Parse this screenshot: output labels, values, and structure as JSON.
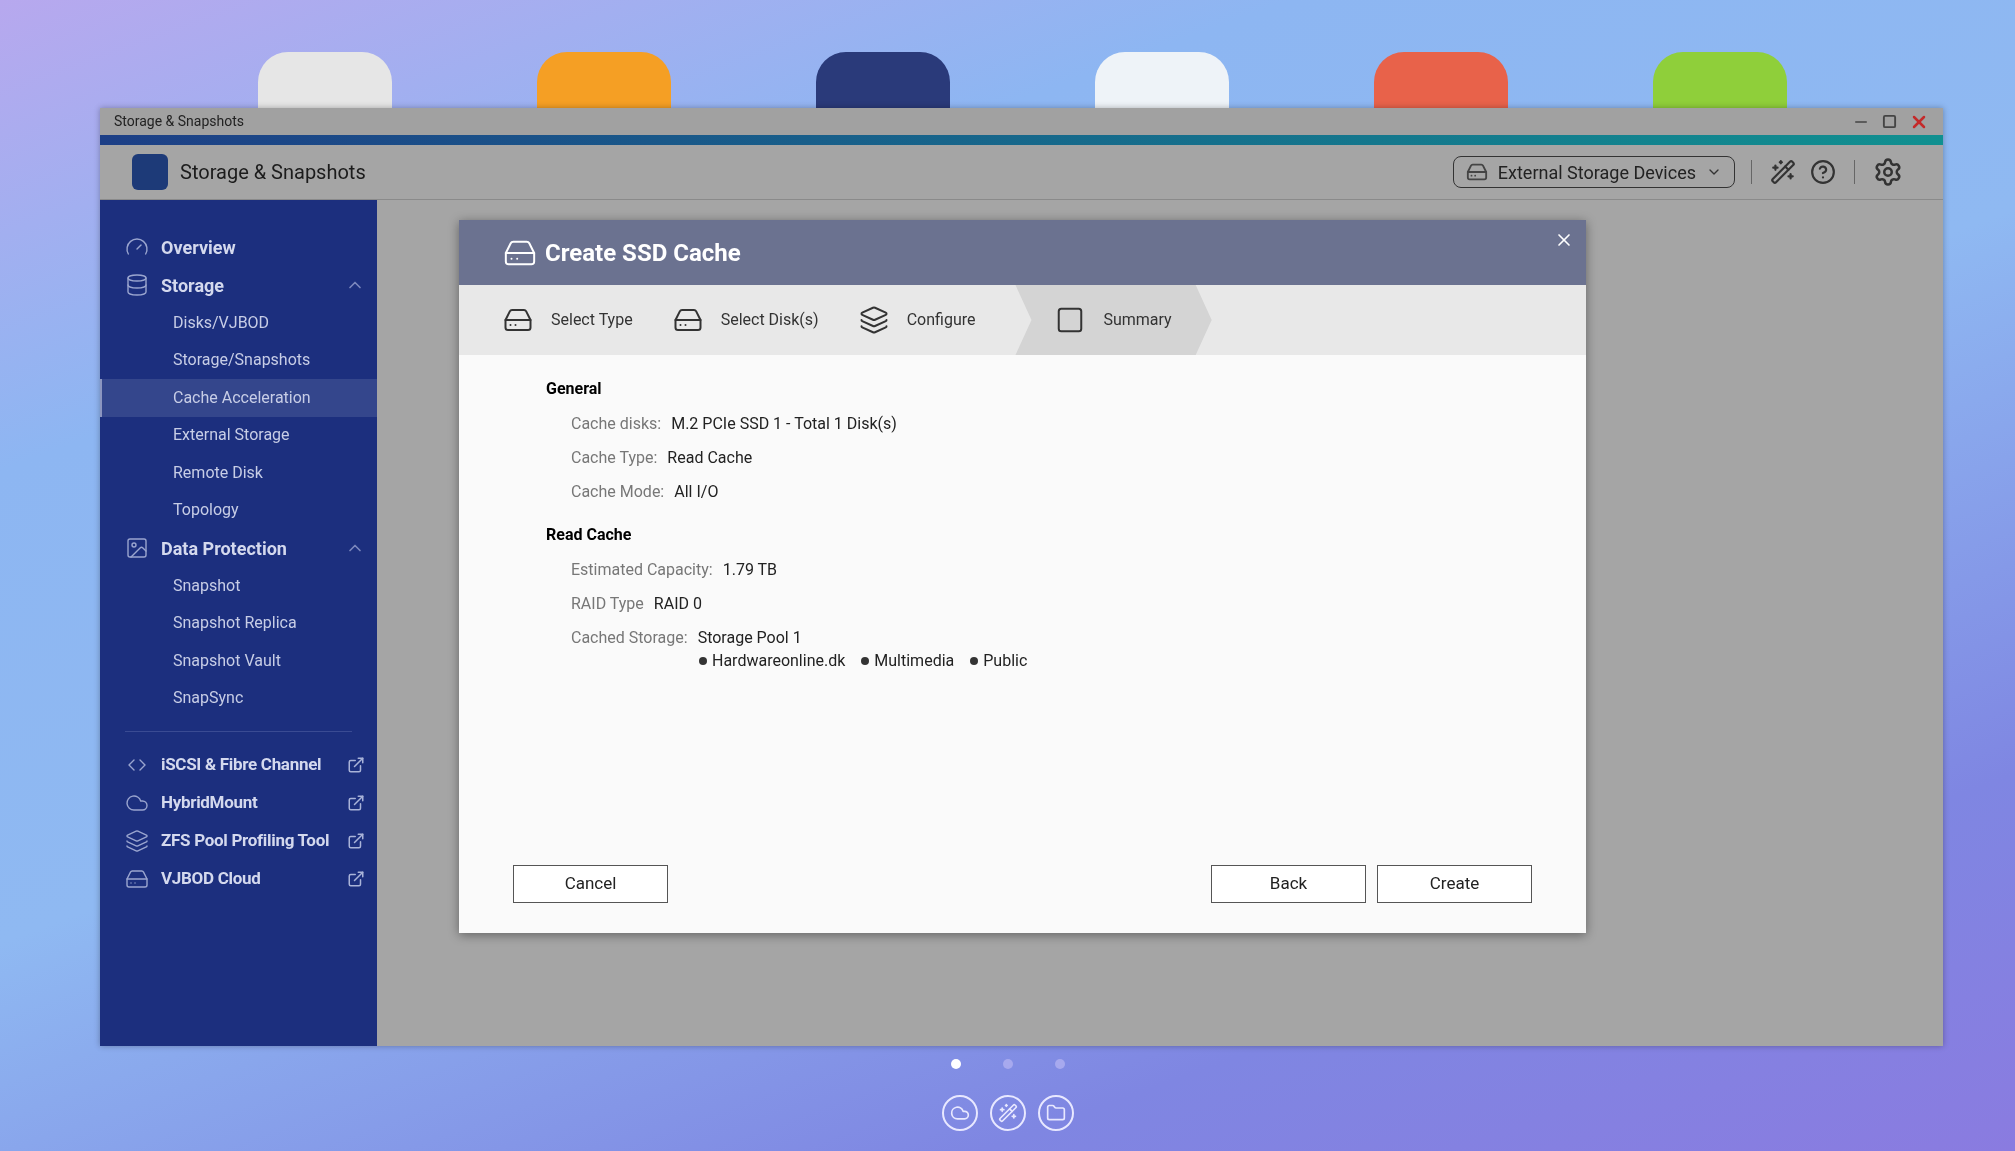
{
  "window": {
    "title": "Storage & Snapshots"
  },
  "app": {
    "title": "Storage & Snapshots",
    "device_selector": "External Storage Devices"
  },
  "sidebar": {
    "items": [
      {
        "kind": "plain",
        "label": "Overview"
      },
      {
        "kind": "group",
        "label": "Storage",
        "expanded": true,
        "children": [
          {
            "label": "Disks/VJBOD",
            "selected": false
          },
          {
            "label": "Storage/Snapshots",
            "selected": false
          },
          {
            "label": "Cache Acceleration",
            "selected": true
          },
          {
            "label": "External Storage",
            "selected": false
          },
          {
            "label": "Remote Disk",
            "selected": false
          },
          {
            "label": "Topology",
            "selected": false
          }
        ]
      },
      {
        "kind": "group",
        "label": "Data Protection",
        "expanded": true,
        "children": [
          {
            "label": "Snapshot",
            "selected": false
          },
          {
            "label": "Snapshot Replica",
            "selected": false
          },
          {
            "label": "Snapshot Vault",
            "selected": false
          },
          {
            "label": "SnapSync",
            "selected": false
          }
        ]
      },
      {
        "kind": "external",
        "label": "iSCSI & Fibre Channel"
      },
      {
        "kind": "external",
        "label": "HybridMount"
      },
      {
        "kind": "external",
        "label": "ZFS Pool Profiling Tool"
      },
      {
        "kind": "external",
        "label": "VJBOD Cloud"
      }
    ]
  },
  "dialog": {
    "title": "Create SSD Cache",
    "steps": [
      {
        "label": "Select Type",
        "selected": false
      },
      {
        "label": "Select Disk(s)",
        "selected": false
      },
      {
        "label": "Configure",
        "selected": false
      },
      {
        "label": "Summary",
        "selected": true
      }
    ],
    "sections": [
      {
        "heading": "General",
        "rows": [
          {
            "label": "Cache disks:",
            "value": "M.2 PCIe SSD 1 - Total 1 Disk(s)"
          },
          {
            "label": "Cache Type:",
            "value": "Read Cache"
          },
          {
            "label": "Cache Mode:",
            "value": "All I/O"
          }
        ]
      },
      {
        "heading": "Read Cache",
        "rows": [
          {
            "label": "Estimated Capacity:",
            "value": "1.79 TB"
          },
          {
            "label": "RAID Type",
            "value": "RAID 0"
          },
          {
            "label": "Cached Storage:",
            "value": "Storage Pool 1",
            "items": [
              "Hardwareonline.dk",
              "Multimedia",
              "Public"
            ]
          }
        ]
      }
    ],
    "buttons": {
      "cancel": "Cancel",
      "back": "Back",
      "create": "Create"
    }
  },
  "desktop": {
    "page_dots": [
      {
        "selected": true
      },
      {
        "selected": false
      },
      {
        "selected": false
      }
    ]
  }
}
